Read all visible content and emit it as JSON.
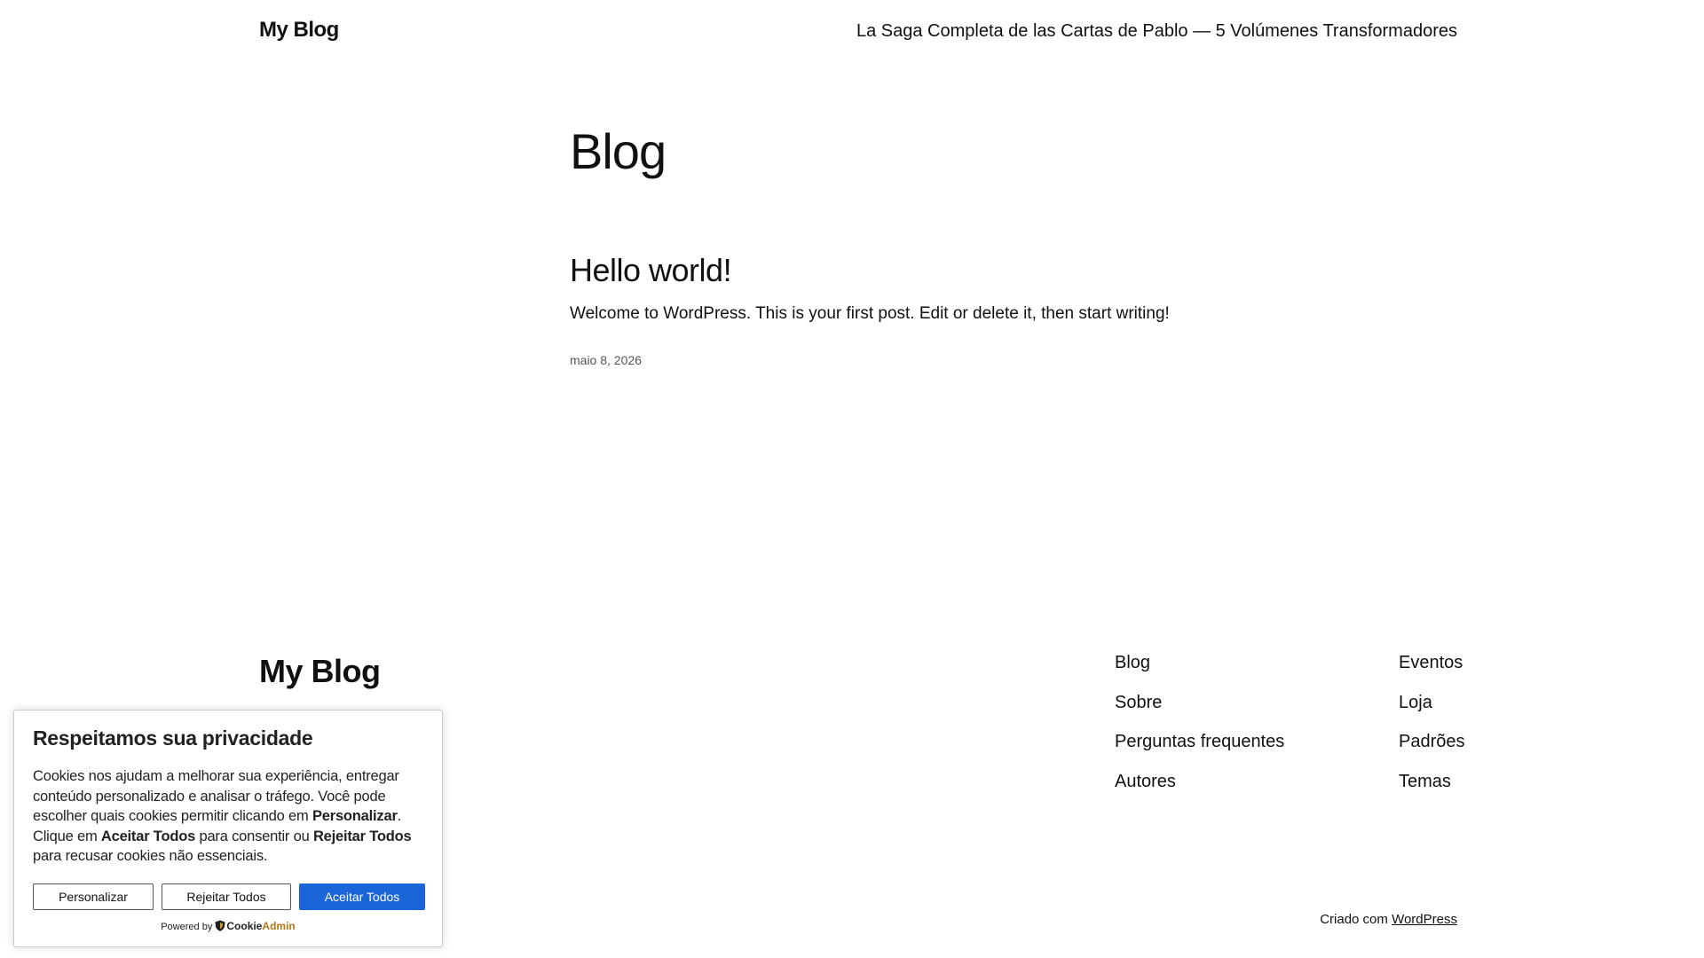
{
  "header": {
    "site_title": "My Blog",
    "nav_link": "La Saga Completa de las Cartas de Pablo — 5 Volúmenes Transformadores"
  },
  "main": {
    "page_title": "Blog",
    "post": {
      "title": "Hello world!",
      "excerpt": "Welcome to WordPress. This is your first post. Edit or delete it, then start writing!",
      "date": "maio 8, 2026"
    }
  },
  "footer": {
    "site_title": "My Blog",
    "col1": [
      "Blog",
      "Sobre",
      "Perguntas frequentes",
      "Autores"
    ],
    "col2": [
      "Eventos",
      "Loja",
      "Padrões",
      "Temas"
    ],
    "credit_prefix": "Criado com",
    "credit_link": "WordPress"
  },
  "cookie_banner": {
    "heading": "Respeitamos sua privacidade",
    "text_1": "Cookies nos ajudam a melhorar sua experiência, entregar conteúdo personalizado e analisar o tráfego. Você pode escolher quais cookies permitir clicando em ",
    "text_customize": "Personalizar",
    "text_2": ". Clique em ",
    "text_accept": "Aceitar Todos",
    "text_3": " para consentir ou ",
    "text_reject": "Rejeitar Todos",
    "text_4": " para recusar cookies não essenciais.",
    "btn_customize": "Personalizar",
    "btn_reject": "Rejeitar Todos",
    "btn_accept": "Aceitar Todos",
    "powered_by": "Powered by",
    "brand_part1": "Cookie",
    "brand_part2": "Admin",
    "accent_color": "#1a66d9",
    "brand_icon": "shield-icon"
  }
}
